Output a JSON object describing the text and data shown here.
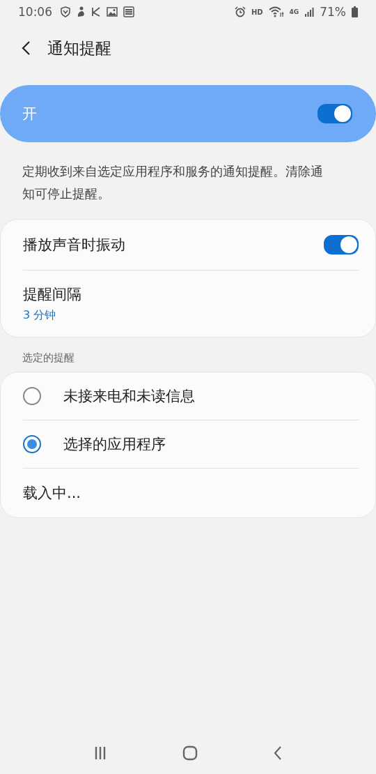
{
  "status_bar": {
    "time": "10:06",
    "hd": "HD",
    "network": "4G",
    "battery": "71%"
  },
  "header": {
    "title": "通知提醒"
  },
  "master_switch": {
    "label": "开",
    "on": true
  },
  "description": "定期收到来自选定应用程序和服务的通知提醒。清除通知可停止提醒。",
  "settings": [
    {
      "kind": "switch",
      "label": "播放声音时振动",
      "on": true
    },
    {
      "kind": "value",
      "label": "提醒间隔",
      "value": "3 分钟"
    }
  ],
  "section_header": "选定的提醒",
  "options": [
    {
      "label": "未接来电和未读信息",
      "selected": false
    },
    {
      "label": "选择的应用程序",
      "selected": true
    }
  ],
  "loading": "载入中..."
}
